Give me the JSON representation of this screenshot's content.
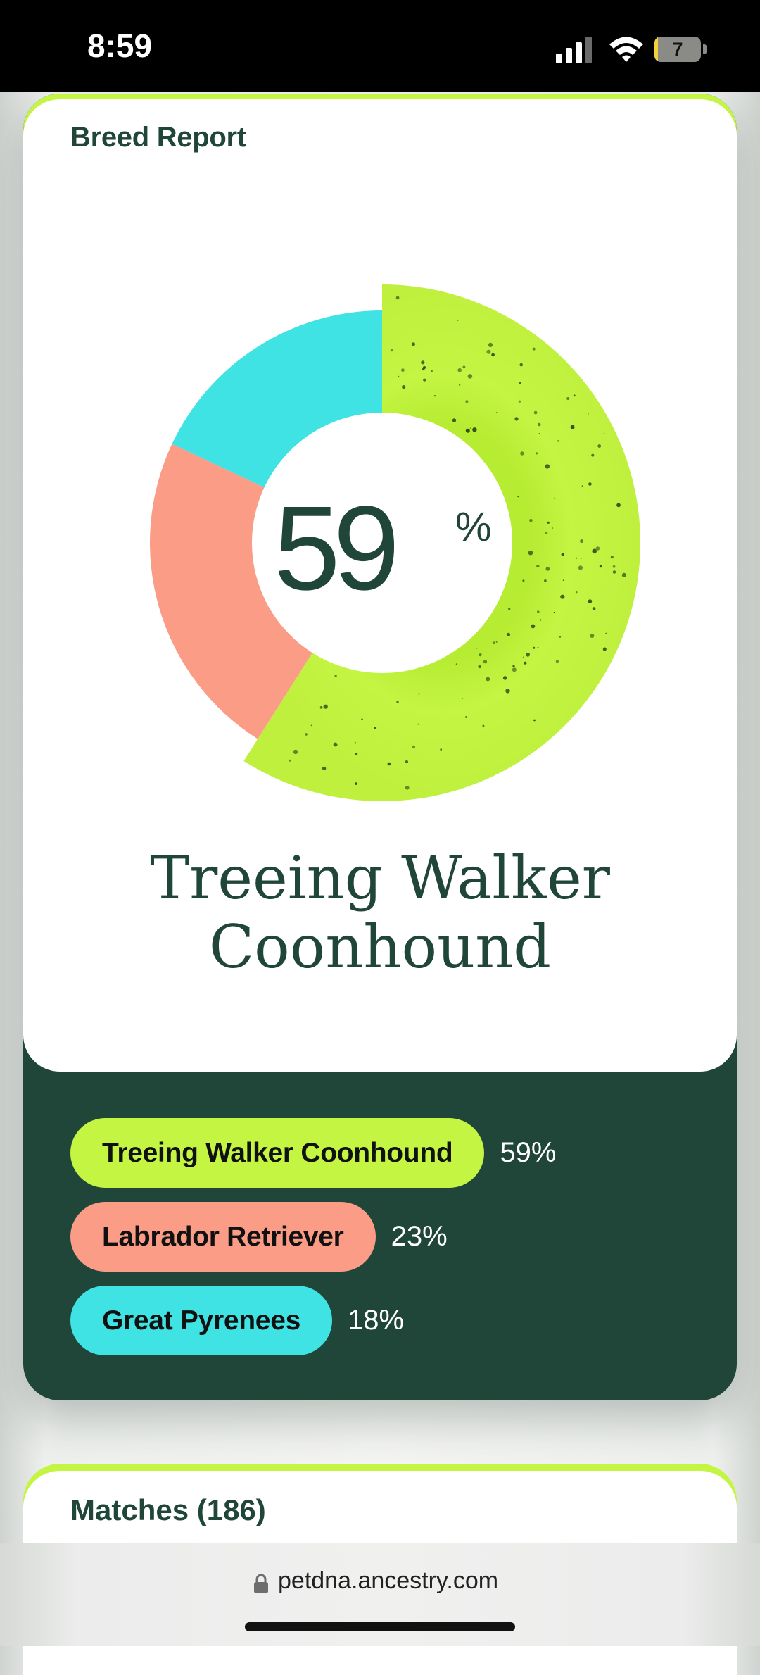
{
  "status_bar": {
    "time": "8:59",
    "battery_level": "7"
  },
  "breed_report": {
    "title": "Breed Report",
    "top_breed": {
      "percent": "59",
      "unit": "%",
      "name": "Treeing Walker Coonhound"
    },
    "breeds": [
      {
        "name": "Treeing Walker Coonhound",
        "percent_label": "59%",
        "color": "#c3f542"
      },
      {
        "name": "Labrador Retriever",
        "percent_label": "23%",
        "color": "#fb9c86"
      },
      {
        "name": "Great Pyrenees",
        "percent_label": "18%",
        "color": "#40e3e3"
      }
    ]
  },
  "chart_data": {
    "type": "pie",
    "categories": [
      "Treeing Walker Coonhound",
      "Labrador Retriever",
      "Great Pyrenees"
    ],
    "values": [
      59,
      23,
      18
    ],
    "colors": [
      "#c3f542",
      "#fb9c86",
      "#40e3e3"
    ],
    "style": "donut",
    "center_label": "59%"
  },
  "matches": {
    "title": "Matches (186)"
  },
  "browser": {
    "url": "petdna.ancestry.com"
  },
  "icons": [
    "cellular-signal-icon",
    "wifi-icon",
    "battery-icon",
    "lock-icon"
  ]
}
